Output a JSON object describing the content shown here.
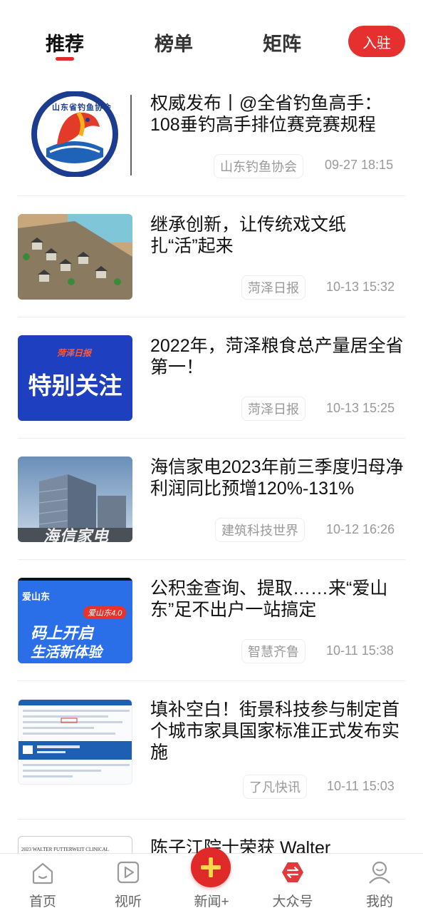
{
  "tabs": [
    {
      "label": "推荐",
      "active": true
    },
    {
      "label": "榜单",
      "active": false
    },
    {
      "label": "矩阵",
      "active": false
    }
  ],
  "join_label": "入驻",
  "news": [
    {
      "title": "权威发布丨@全省钓鱼高手：108垂钓高手排位赛竞赛规程",
      "source": "山东钓鱼协会",
      "time": "09-27 18:15",
      "thumb": "logo",
      "logo_text": "山东省钓鱼协会"
    },
    {
      "title": "继承创新，让传统戏文纸扎“活”起来",
      "source": "菏泽日报",
      "time": "10-13 15:32",
      "thumb": "model"
    },
    {
      "title": "2022年，菏泽粮食总产量居全省第一！",
      "source": "菏泽日报",
      "time": "10-13 15:25",
      "thumb": "banner",
      "banner_small": "菏泽日报",
      "banner_text": "特别关注"
    },
    {
      "title": "海信家电2023年前三季度归母净利润同比预增120%-131%",
      "source": "建筑科技世界",
      "time": "10-12 16:26",
      "thumb": "building",
      "building_text": "海信家电"
    },
    {
      "title": "公积金查询、提取……来“爱山东”足不出户一站搞定",
      "source": "智慧齐鲁",
      "time": "10-11 15:38",
      "thumb": "promo",
      "promo_top": "爱山东",
      "promo_tag": "爱山东4.0",
      "promo_line1": "码上开启",
      "promo_line2": "生活新体验"
    },
    {
      "title": "填补空白！街景科技参与制定首个城市家具国家标准正式发布实施",
      "source": "了凡快讯",
      "time": "10-11 15:03",
      "thumb": "doc"
    },
    {
      "title": "陈子江院士荣获 Walter",
      "thumb": "paper",
      "paper_text": "2023 WALTER FUTTERWEIT CLINICAL"
    }
  ],
  "bottom_nav": [
    {
      "label": "首页",
      "icon": "home-icon"
    },
    {
      "label": "视听",
      "icon": "play-icon"
    },
    {
      "label": "新闻+",
      "icon": "plus-icon"
    },
    {
      "label": "大众号",
      "icon": "swap-icon"
    },
    {
      "label": "我的",
      "icon": "user-icon"
    }
  ],
  "colors": {
    "accent": "#e02b2b",
    "muted": "#999999"
  }
}
